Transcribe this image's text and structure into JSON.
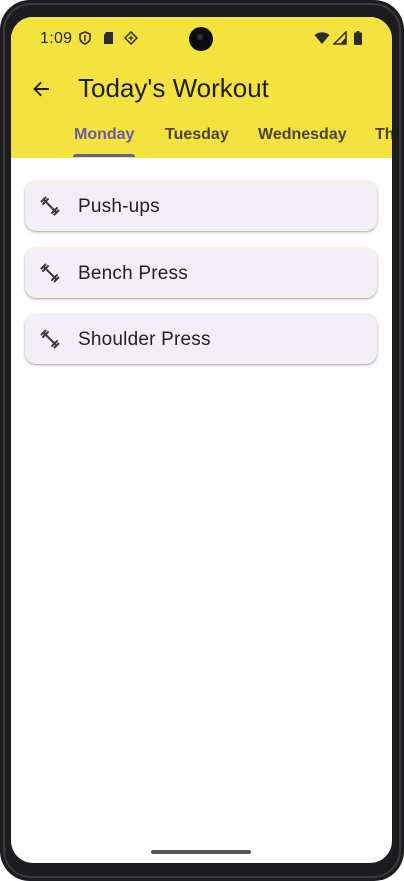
{
  "status_bar": {
    "time": "1:09",
    "icons": [
      "shield-icon",
      "sd-card-icon",
      "diamond-icon",
      "wifi-icon",
      "cell-signal-icon",
      "battery-icon"
    ]
  },
  "app_bar": {
    "color": "#f4e23f",
    "back_icon": "arrow-back-icon",
    "title": "Today's Workout"
  },
  "tabs": {
    "active_color": "#6b5aa5",
    "items": [
      {
        "label": "Monday",
        "active": true
      },
      {
        "label": "Tuesday",
        "active": false
      },
      {
        "label": "Wednesday",
        "active": false
      },
      {
        "label": "Thursday",
        "active": false
      }
    ]
  },
  "exercises": [
    {
      "name": "Push-ups",
      "icon": "fitness-dumbbell-icon"
    },
    {
      "name": "Bench Press",
      "icon": "fitness-dumbbell-icon"
    },
    {
      "name": "Shoulder Press",
      "icon": "fitness-dumbbell-icon"
    }
  ]
}
